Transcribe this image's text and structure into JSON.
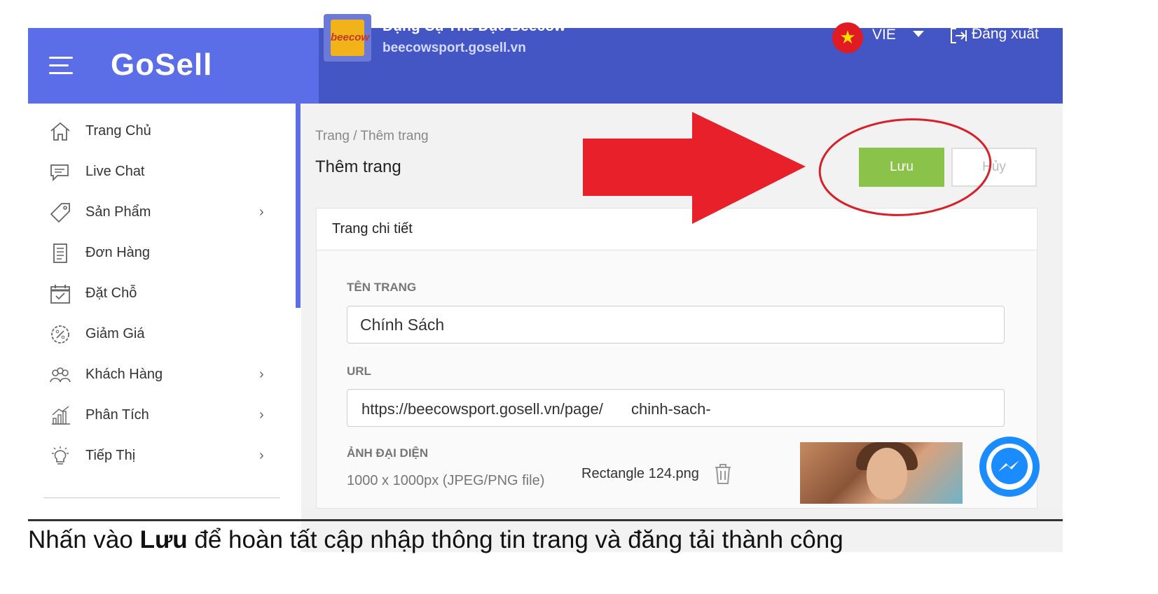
{
  "header": {
    "logo": "GoSell",
    "store_name": "Dụng Cụ Thể Dục Beecow",
    "store_url": "beecowsport.gosell.vn",
    "store_logo_text": "beecow",
    "language": "VIE",
    "logout_label": "Đăng xuất"
  },
  "sidebar": {
    "items": [
      {
        "label": "Trang Chủ",
        "icon": "home-icon",
        "has_submenu": false
      },
      {
        "label": "Live Chat",
        "icon": "chat-icon",
        "has_submenu": false
      },
      {
        "label": "Sản Phẩm",
        "icon": "tag-icon",
        "has_submenu": true
      },
      {
        "label": "Đơn Hàng",
        "icon": "document-icon",
        "has_submenu": false
      },
      {
        "label": "Đặt Chỗ",
        "icon": "calendar-icon",
        "has_submenu": false
      },
      {
        "label": "Giảm Giá",
        "icon": "discount-icon",
        "has_submenu": false
      },
      {
        "label": "Khách Hàng",
        "icon": "users-icon",
        "has_submenu": true
      },
      {
        "label": "Phân Tích",
        "icon": "analytics-icon",
        "has_submenu": true
      },
      {
        "label": "Tiếp Thị",
        "icon": "lightbulb-icon",
        "has_submenu": true
      }
    ],
    "chevron": "›"
  },
  "page": {
    "breadcrumb": "Trang / Thêm trang",
    "title": "Thêm trang",
    "save_label": "Lưu",
    "cancel_label": "Hủy"
  },
  "card": {
    "title": "Trang chi tiết",
    "name_label": "TÊN TRANG",
    "name_value": "Chính Sách",
    "url_label": "URL",
    "url_prefix": "https://beecowsport.gosell.vn/page/",
    "url_slug": "chinh-sach-",
    "avatar_label": "ẢNH ĐẠI DIỆN",
    "avatar_hint": "1000 x 1000px (JPEG/PNG file)",
    "avatar_file": "Rectangle 124.png"
  },
  "caption": {
    "prefix": "Nhấn vào ",
    "bold": "Lưu",
    "suffix": " để hoàn tất cập nhập thông tin trang và đăng tải thành công"
  },
  "colors": {
    "topbar_left": "#5b6ee8",
    "topbar_right": "#4456c4",
    "save_button": "#8bc34a",
    "annotation_red": "#e8202a",
    "messenger": "#1a8cff"
  }
}
